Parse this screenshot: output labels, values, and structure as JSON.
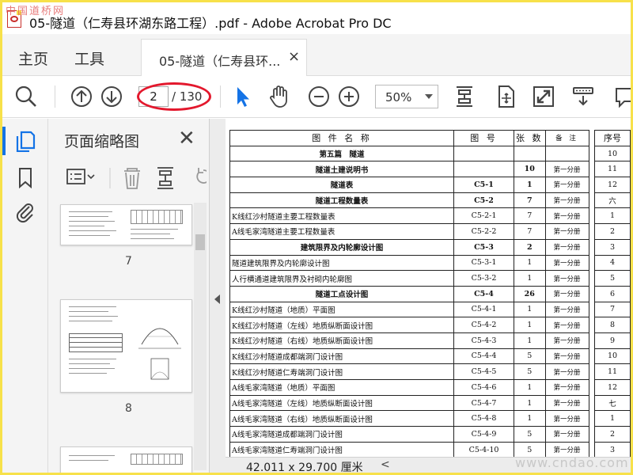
{
  "window": {
    "title": "05-隧道（仁寿县环湖东路工程）.pdf - Adobe Acrobat Pro DC",
    "watermark": "中国道桥网"
  },
  "menu": {
    "home": "主页",
    "tools": "工具",
    "doc_tab": "05-隧道（仁寿县环...",
    "close_glyph": "×"
  },
  "toolbar": {
    "current_page": "2",
    "total_pages": "/ 130",
    "zoom": "50%"
  },
  "thumbnails": {
    "title": "页面缩略图",
    "close_glyph": "✕",
    "pages": [
      "7",
      "8"
    ]
  },
  "document": {
    "headers": [
      "图 件 名 称",
      "图 号",
      "张 数",
      "备 注"
    ],
    "rows": [
      {
        "name": "第五篇　隧道",
        "code": "",
        "count": "",
        "note": "",
        "style": "center-bold"
      },
      {
        "name": "隧道土建说明书",
        "code": "",
        "count": "10",
        "note": "第一分册",
        "style": "center-bold"
      },
      {
        "name": "隧道表",
        "code": "C5-1",
        "count": "1",
        "note": "第一分册",
        "style": "center-bold"
      },
      {
        "name": "隧道工程数量表",
        "code": "C5-2",
        "count": "7",
        "note": "第一分册",
        "style": "center-bold"
      },
      {
        "name": "K线红沙村隧道主要工程数量表",
        "code": "C5-2-1",
        "count": "7",
        "note": "第一分册",
        "style": ""
      },
      {
        "name": "A线毛家湾隧道主要工程数量表",
        "code": "C5-2-2",
        "count": "7",
        "note": "第一分册",
        "style": ""
      },
      {
        "name": "建筑限界及内轮廓设计图",
        "code": "C5-3",
        "count": "2",
        "note": "第一分册",
        "style": "center-bold"
      },
      {
        "name": "隧道建筑限界及内轮廓设计图",
        "code": "C5-3-1",
        "count": "1",
        "note": "第一分册",
        "style": ""
      },
      {
        "name": "人行横通道建筑限界及衬砌内轮廓图",
        "code": "C5-3-2",
        "count": "1",
        "note": "第一分册",
        "style": ""
      },
      {
        "name": "隧道工点设计图",
        "code": "C5-4",
        "count": "26",
        "note": "第一分册",
        "style": "center-bold"
      },
      {
        "name": "K线红沙村隧道（地质）平面图",
        "code": "C5-4-1",
        "count": "1",
        "note": "第一分册",
        "style": ""
      },
      {
        "name": "K线红沙村隧道（左线）地质纵断面设计图",
        "code": "C5-4-2",
        "count": "1",
        "note": "第一分册",
        "style": ""
      },
      {
        "name": "K线红沙村隧道（右线）地质纵断面设计图",
        "code": "C5-4-3",
        "count": "1",
        "note": "第一分册",
        "style": ""
      },
      {
        "name": "K线红沙村隧道成都端洞门设计图",
        "code": "C5-4-4",
        "count": "5",
        "note": "第一分册",
        "style": ""
      },
      {
        "name": "K线红沙村隧道仁寿端洞门设计图",
        "code": "C5-4-5",
        "count": "5",
        "note": "第一分册",
        "style": ""
      },
      {
        "name": "A线毛家湾隧道（地质）平面图",
        "code": "C5-4-6",
        "count": "1",
        "note": "第一分册",
        "style": ""
      },
      {
        "name": "A线毛家湾隧道（左线）地质纵断面设计图",
        "code": "C5-4-7",
        "count": "1",
        "note": "第一分册",
        "style": ""
      },
      {
        "name": "A线毛家湾隧道（右线）地质纵断面设计图",
        "code": "C5-4-8",
        "count": "1",
        "note": "第一分册",
        "style": ""
      },
      {
        "name": "A线毛家湾隧道成都端洞门设计图",
        "code": "C5-4-9",
        "count": "5",
        "note": "第一分册",
        "style": ""
      },
      {
        "name": "A线毛家湾隧道仁寿端洞门设计图",
        "code": "C5-4-10",
        "count": "5",
        "note": "第一分册",
        "style": ""
      }
    ],
    "side_header": "序号",
    "side_rows": [
      "10",
      "11",
      "12",
      "六",
      "1",
      "2",
      "3",
      "4",
      "5",
      "6",
      "7",
      "8",
      "9",
      "10",
      "11",
      "12",
      "七",
      "1",
      "2",
      "3"
    ]
  },
  "status": {
    "dimensions": "42.011 x 29.700 厘米",
    "scroll_left": "<"
  },
  "footer_watermark": "www.cndao.com",
  "colors": {
    "frame": "#f7e14a",
    "accent_blue": "#1473e6",
    "highlight_red": "#e3182d"
  }
}
